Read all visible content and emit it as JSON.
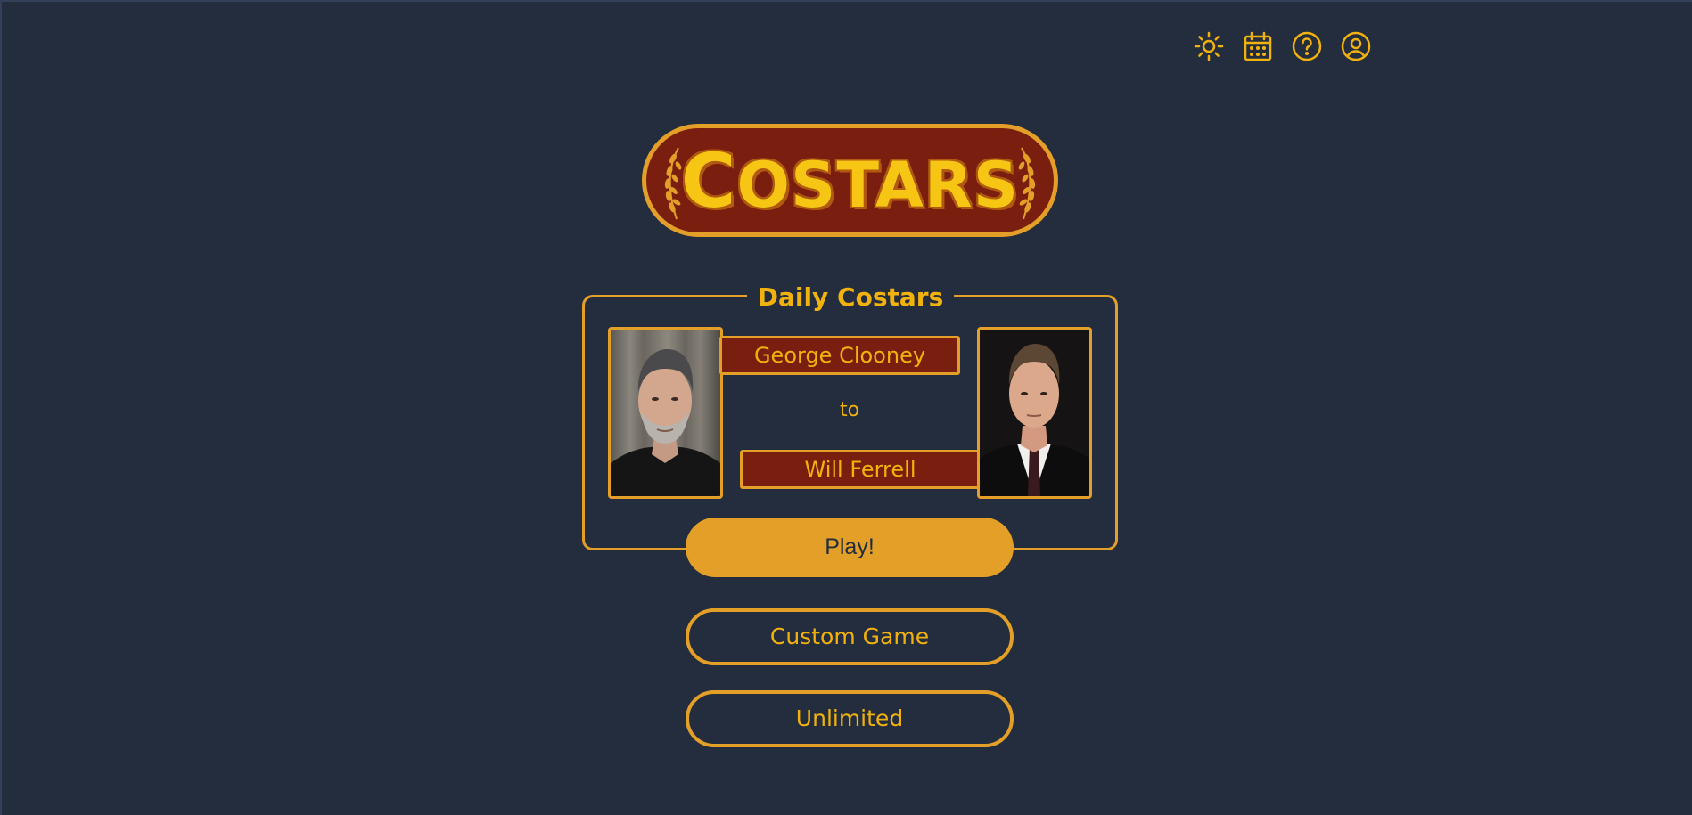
{
  "header": {
    "icons": [
      "sun-icon",
      "calendar-icon",
      "help-icon",
      "account-icon"
    ]
  },
  "logo": {
    "text_first": "C",
    "text_rest": "OSTARS"
  },
  "daily": {
    "title": "Daily Costars",
    "start_actor": "George Clooney",
    "connector": "to",
    "end_actor": "Will Ferrell",
    "play_label": "Play!"
  },
  "menu": {
    "custom_label": "Custom Game",
    "unlimited_label": "Unlimited"
  },
  "colors": {
    "background": "#232d3d",
    "gold": "#f2b20e",
    "orange": "#e39f27",
    "maroon": "#7a1f10"
  }
}
